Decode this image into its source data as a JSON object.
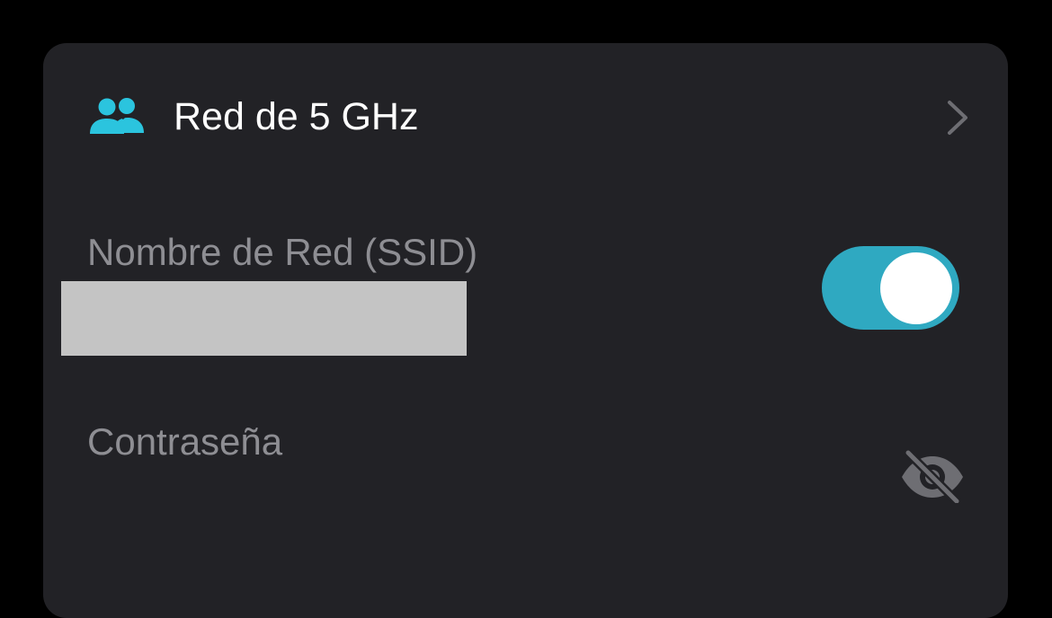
{
  "network": {
    "title": "Red de 5 GHz",
    "icon": "group-users-icon",
    "chevron_icon": "chevron-right-icon"
  },
  "ssid": {
    "label": "Nombre de Red (SSID)",
    "value": "",
    "enabled": true
  },
  "password": {
    "label": "Contraseña",
    "visibility_icon": "eye-off-icon"
  },
  "colors": {
    "background": "#000000",
    "card": "#222226",
    "accent": "#2fa9c1",
    "icon_accent": "#2bc4de",
    "label_gray": "#8e8e93",
    "redacted": "#c4c4c4"
  }
}
